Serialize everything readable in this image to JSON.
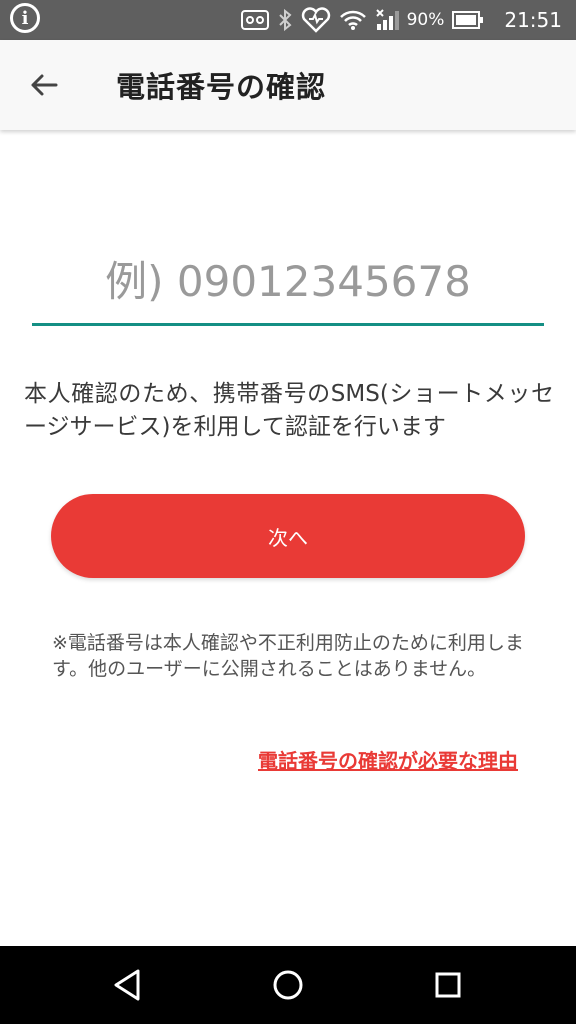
{
  "status_bar": {
    "battery_percent": "90%",
    "time": "21:51",
    "icons": [
      "info-icon",
      "voicemail-icon",
      "bluetooth-icon",
      "heart-icon",
      "wifi-icon",
      "signal-icon",
      "battery-icon"
    ]
  },
  "header": {
    "title": "電話番号の確認",
    "back_icon": "arrow-left-icon"
  },
  "form": {
    "phone_placeholder": "例) 09012345678",
    "phone_value": "",
    "underline_color": "#148f84",
    "description": "本人確認のため、携帯番号のSMS(ショートメッセージサービス)を利用して認証を行います",
    "next_button_label": "次へ",
    "button_color": "#e93a36",
    "notice": "※電話番号は本人確認や不正利用防止のために利用します。他のユーザーに公開されることはありません。",
    "reason_link": "電話番号の確認が必要な理由"
  },
  "nav_bar": {
    "buttons": [
      "back-triangle-icon",
      "home-circle-icon",
      "recents-square-icon"
    ]
  }
}
